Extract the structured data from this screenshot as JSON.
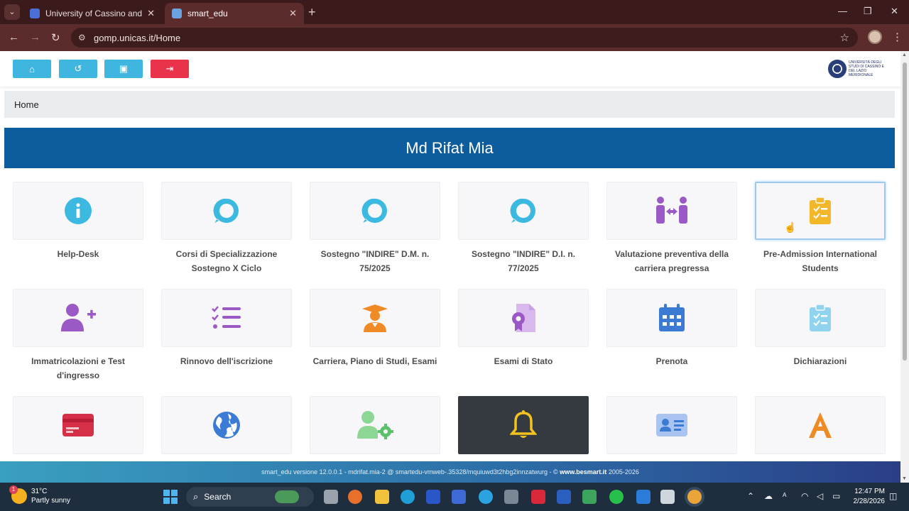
{
  "browser": {
    "tabs": [
      {
        "title": "University of Cassino and South",
        "favicon_color": "#4a6fd6"
      },
      {
        "title": "smart_edu",
        "favicon_color": "#6aa3e0"
      }
    ],
    "url": "gomp.unicas.it/Home"
  },
  "topbar": {
    "buttons": [
      {
        "icon": "home-icon",
        "glyph": "⌂",
        "color": "#3fb6e0"
      },
      {
        "icon": "history-icon",
        "glyph": "↺",
        "color": "#3fb6e0"
      },
      {
        "icon": "id-card-icon",
        "glyph": "▣",
        "color": "#3fb6e0"
      },
      {
        "icon": "logout-icon",
        "glyph": "⇥",
        "color": "#e8334a"
      }
    ],
    "logo_text": "UNIVERSITÀ DEGLI STUDI DI CASSINO E DEL LAZIO MERIDIONALE"
  },
  "breadcrumb": "Home",
  "banner": "Md Rifat Mia",
  "cards": [
    {
      "label": "Help-Desk",
      "icon": "info-circle-icon",
      "color": "#3cb9e0"
    },
    {
      "label": "Corsi di Specializzazione Sostegno X Ciclo",
      "icon": "chat-bubble-icon",
      "color": "#3cb9e0"
    },
    {
      "label": "Sostegno \"INDIRE\" D.M. n. 75/2025",
      "icon": "chat-bubble-icon",
      "color": "#3cb9e0"
    },
    {
      "label": "Sostegno \"INDIRE\" D.I. n. 77/2025",
      "icon": "chat-bubble-icon",
      "color": "#3cb9e0"
    },
    {
      "label": "Valutazione preventiva della carriera pregressa",
      "icon": "people-arrows-icon",
      "color": "#9b59c6"
    },
    {
      "label": "Pre-Admission International Students",
      "icon": "clipboard-check-icon",
      "color": "#f3b82a"
    },
    {
      "label": "Immatricolazioni e Test d'ingresso",
      "icon": "user-plus-icon",
      "color": "#9b59c6"
    },
    {
      "label": "Rinnovo dell'iscrizione",
      "icon": "list-check-icon",
      "color": "#9b59c6"
    },
    {
      "label": "Carriera, Piano di Studi, Esami",
      "icon": "graduate-icon",
      "color": "#f08a24"
    },
    {
      "label": "Esami di Stato",
      "icon": "certificate-file-icon",
      "color": "#9b59c6"
    },
    {
      "label": "Prenota",
      "icon": "calendar-icon",
      "color": "#3b7bd4"
    },
    {
      "label": "Dichiarazioni",
      "icon": "clipboard-list-icon",
      "color": "#8fd3ee"
    },
    {
      "label": "",
      "icon": "credit-card-icon",
      "color": "#d63048"
    },
    {
      "label": "",
      "icon": "globe-icon",
      "color": "#3b7bd4"
    },
    {
      "label": "",
      "icon": "user-gear-icon",
      "color": "#5cc16a"
    },
    {
      "label": "",
      "icon": "bell-icon",
      "color": "#f3c21e"
    },
    {
      "label": "",
      "icon": "contact-card-icon",
      "color": "#7fa6e8"
    },
    {
      "label": "",
      "icon": "letter-a-icon",
      "color": "#f08a24"
    }
  ],
  "footer": {
    "text": "smart_edu versione 12.0.0.1 - mdrifat.mia-2 @ smartedu-vmweb-.35328/mquiuwd3t2hbg2innzatwurg - ©",
    "link": "www.besmart.it",
    "years": "2005-2026"
  },
  "taskbar": {
    "temperature": "31°C",
    "weather": "Partly sunny",
    "weather_badge": "1",
    "search_placeholder": "Search",
    "time": "12:47 PM",
    "date": "2/28/2026"
  }
}
